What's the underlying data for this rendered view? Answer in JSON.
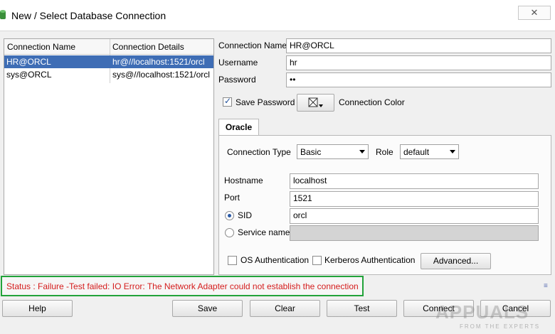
{
  "window": {
    "title": "New / Select Database Connection",
    "close_glyph": "✕"
  },
  "connections": {
    "headers": [
      "Connection Name",
      "Connection Details"
    ],
    "rows": [
      {
        "name": "HR@ORCL",
        "details": "hr@//localhost:1521/orcl",
        "selected": true
      },
      {
        "name": "sys@ORCL",
        "details": "sys@//localhost:1521/orcl",
        "selected": false
      }
    ]
  },
  "form": {
    "connection_name_label": "Connection Name",
    "connection_name_value": "HR@ORCL",
    "username_label": "Username",
    "username_value": "hr",
    "password_label": "Password",
    "password_value": "••",
    "save_password_label": "Save Password",
    "save_password_checked": true,
    "connection_color_label": "Connection Color"
  },
  "tab": {
    "label": "Oracle",
    "connection_type_label": "Connection Type",
    "connection_type_value": "Basic",
    "role_label": "Role",
    "role_value": "default",
    "hostname_label": "Hostname",
    "hostname_value": "localhost",
    "port_label": "Port",
    "port_value": "1521",
    "sid_label": "SID",
    "sid_value": "orcl",
    "sid_selected": true,
    "service_name_label": "Service name",
    "service_name_value": "",
    "os_auth_label": "OS Authentication",
    "kerberos_auth_label": "Kerberos Authentication",
    "advanced_label": "Advanced..."
  },
  "status": {
    "text": "Status : Failure -Test failed: IO Error: The Network Adapter could not establish the connection",
    "text_color": "#d41c1c",
    "highlight_color": "#22a33a"
  },
  "buttons": {
    "help": "Help",
    "save": "Save",
    "clear": "Clear",
    "test": "Test",
    "connect": "Connect",
    "cancel": "Cancel"
  },
  "watermark": {
    "text": "APPUALS",
    "sub": "FROM THE EXPERTS"
  },
  "colors": {
    "selection": "#3e6db5",
    "accent": "#1f4f9a"
  }
}
